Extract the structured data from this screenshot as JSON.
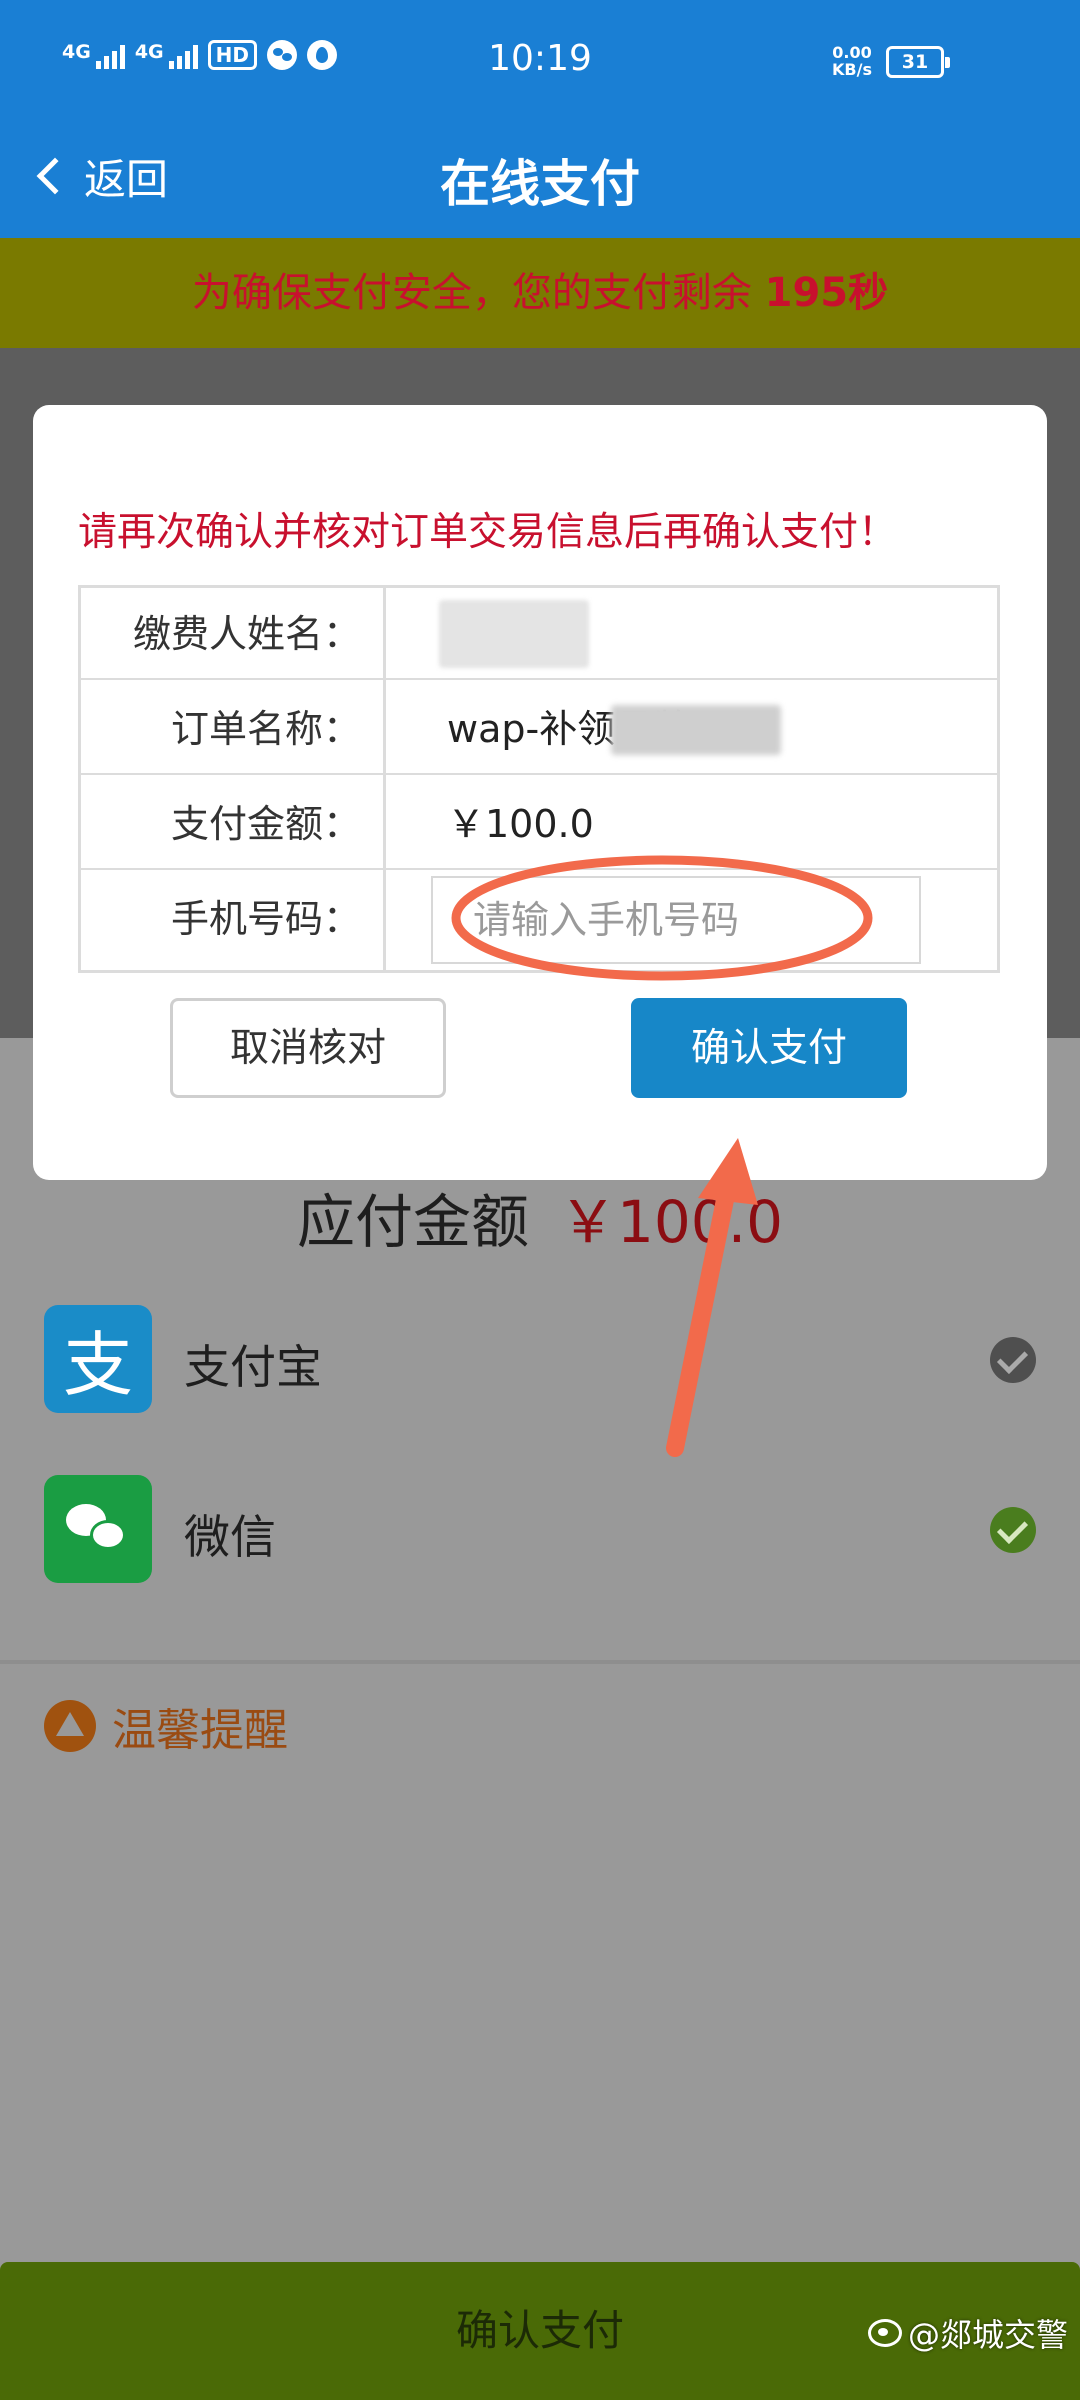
{
  "status_bar": {
    "network_1": "4G",
    "network_2": "4G",
    "hd_badge": "HD",
    "time": "10:19",
    "speed_value": "0.00",
    "speed_unit": "KB/s",
    "battery": "31"
  },
  "nav": {
    "back_label": "返回",
    "title": "在线支付"
  },
  "timer": {
    "prefix": "为确保支付安全，您的支付剩余 ",
    "seconds": "195秒"
  },
  "page": {
    "total_label": "应付金额",
    "total_amount": "￥100.0",
    "payment_methods": [
      {
        "name": "支付宝",
        "icon": "alipay-icon"
      },
      {
        "name": "微信",
        "icon": "wechat-icon"
      }
    ],
    "reminder": "温馨提醒",
    "bottom_button": "确认支付"
  },
  "modal": {
    "warning": "请再次确认并核对订单交易信息后再确认支付！",
    "rows": [
      {
        "label": "缴费人姓名：",
        "value": ""
      },
      {
        "label": "订单名称：",
        "value": "wap-补领号牌"
      },
      {
        "label": "支付金额：",
        "value": "￥100.0"
      },
      {
        "label": "手机号码：",
        "placeholder": "请输入手机号码"
      }
    ],
    "cancel_button": "取消核对",
    "confirm_button": "确认支付"
  },
  "watermark": "@郯城交警",
  "colors": {
    "primary_blue": "#1a7fd4",
    "warning_red": "#c8102e",
    "confirm_blue": "#1787c8",
    "annotation_orange": "#f26a4b"
  }
}
